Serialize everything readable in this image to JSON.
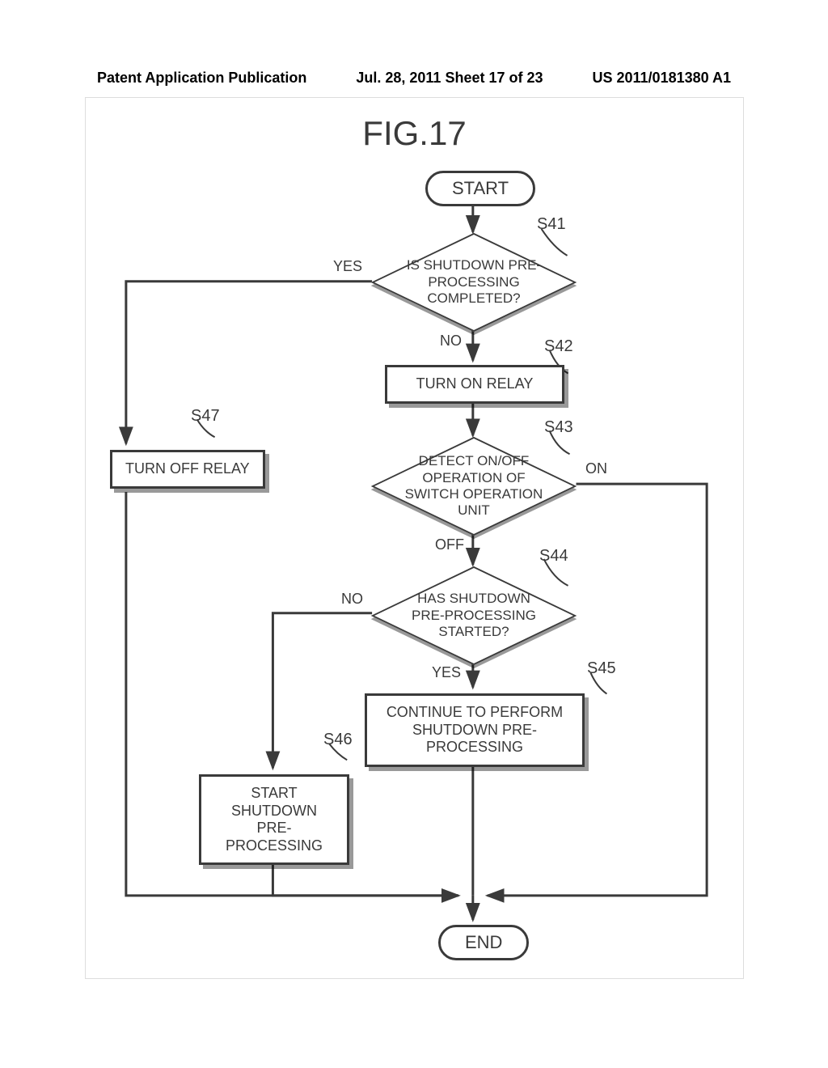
{
  "header": {
    "left": "Patent Application Publication",
    "center": "Jul. 28, 2011  Sheet 17 of 23",
    "right": "US 2011/0181380 A1"
  },
  "figure_title": "FIG.17",
  "nodes": {
    "start": "START",
    "end": "END",
    "s41": "IS SHUTDOWN PRE-PROCESSING COMPLETED?",
    "s42": "TURN ON RELAY",
    "s43": "DETECT ON/OFF OPERATION OF SWITCH OPERATION UNIT",
    "s44": "HAS SHUTDOWN PRE-PROCESSING STARTED?",
    "s45": "CONTINUE TO PERFORM SHUTDOWN PRE-PROCESSING",
    "s46": "START SHUTDOWN PRE-PROCESSING",
    "s47": "TURN OFF RELAY"
  },
  "labels": {
    "yes": "YES",
    "no": "NO",
    "on": "ON",
    "off": "OFF"
  },
  "steps": {
    "s41": "S41",
    "s42": "S42",
    "s43": "S43",
    "s44": "S44",
    "s45": "S45",
    "s46": "S46",
    "s47": "S47"
  }
}
